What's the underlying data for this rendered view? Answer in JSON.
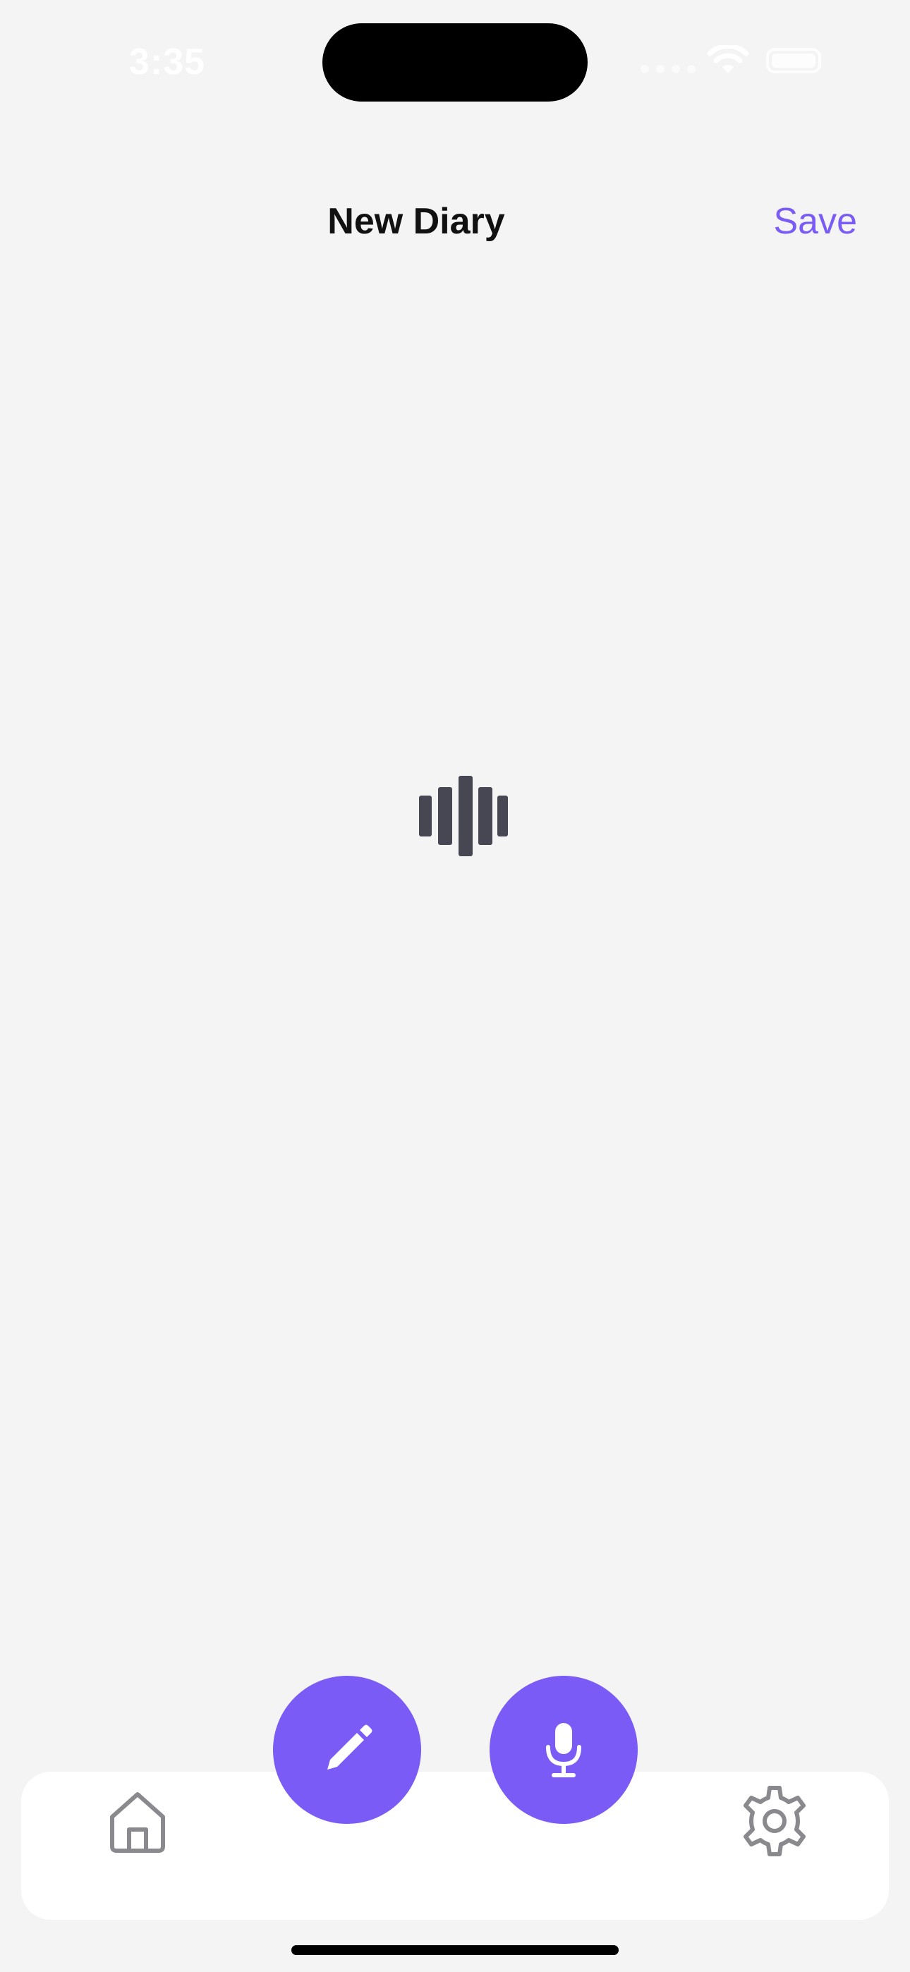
{
  "status_bar": {
    "time": "3:35"
  },
  "nav": {
    "title": "New Diary",
    "save_label": "Save"
  },
  "recording": {
    "indicator_icon": "audio-waveform-icon"
  },
  "fabs": {
    "write_icon": "pencil-icon",
    "voice_icon": "microphone-icon"
  },
  "tab_bar": {
    "items": [
      {
        "icon": "home-icon"
      },
      {
        "icon": "gear-icon"
      }
    ]
  },
  "colors": {
    "accent": "#7b5bf5",
    "background": "#f4f4f4",
    "waveform": "#464752",
    "tab_bar_bg": "#ffffff",
    "tab_icon": "#8a8a8e"
  }
}
